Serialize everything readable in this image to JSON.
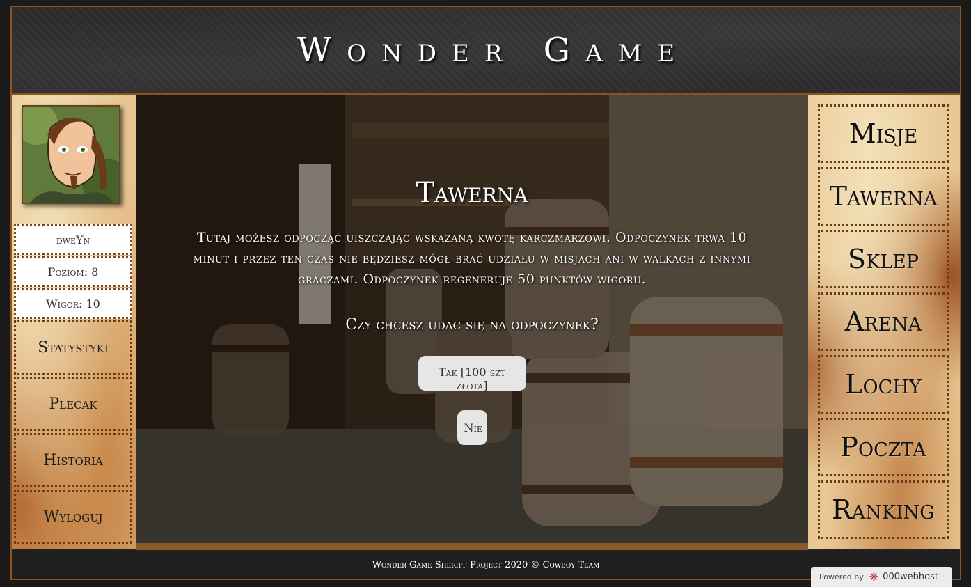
{
  "header": {
    "title": "Wonder Game"
  },
  "player": {
    "name": "dweYn",
    "level_text": "Poziom: 8",
    "vigor_text": "Wigor: 10"
  },
  "left_nav": [
    {
      "label": "Statystyki"
    },
    {
      "label": "Plecak"
    },
    {
      "label": "Historia"
    },
    {
      "label": "Wyloguj"
    }
  ],
  "tavern": {
    "title": "Tawerna",
    "description": "Tutaj możesz odpocząć uiszczając wskazaną kwotę karczmarzowi. Odpoczynek trwa 10 minut i przez ten czas nie będziesz mógł brać udziału w misjach ani w walkach z innymi graczami. Odpoczynek regeneruje 50 punktów wigoru.",
    "question": "Czy chcesz udać się na odpoczynek?",
    "yes_label": "Tak [100 szt złota]",
    "no_label": "Nie"
  },
  "right_nav": [
    {
      "label": "Misje"
    },
    {
      "label": "Tawerna"
    },
    {
      "label": "Sklep"
    },
    {
      "label": "Arena"
    },
    {
      "label": "Lochy"
    },
    {
      "label": "Poczta"
    },
    {
      "label": "Ranking"
    }
  ],
  "footer": {
    "text": "Wonder Game Sheriff Project 2020 © Cowboy Team"
  },
  "powered": {
    "prefix": "Powered by",
    "brand": "000webhost"
  }
}
